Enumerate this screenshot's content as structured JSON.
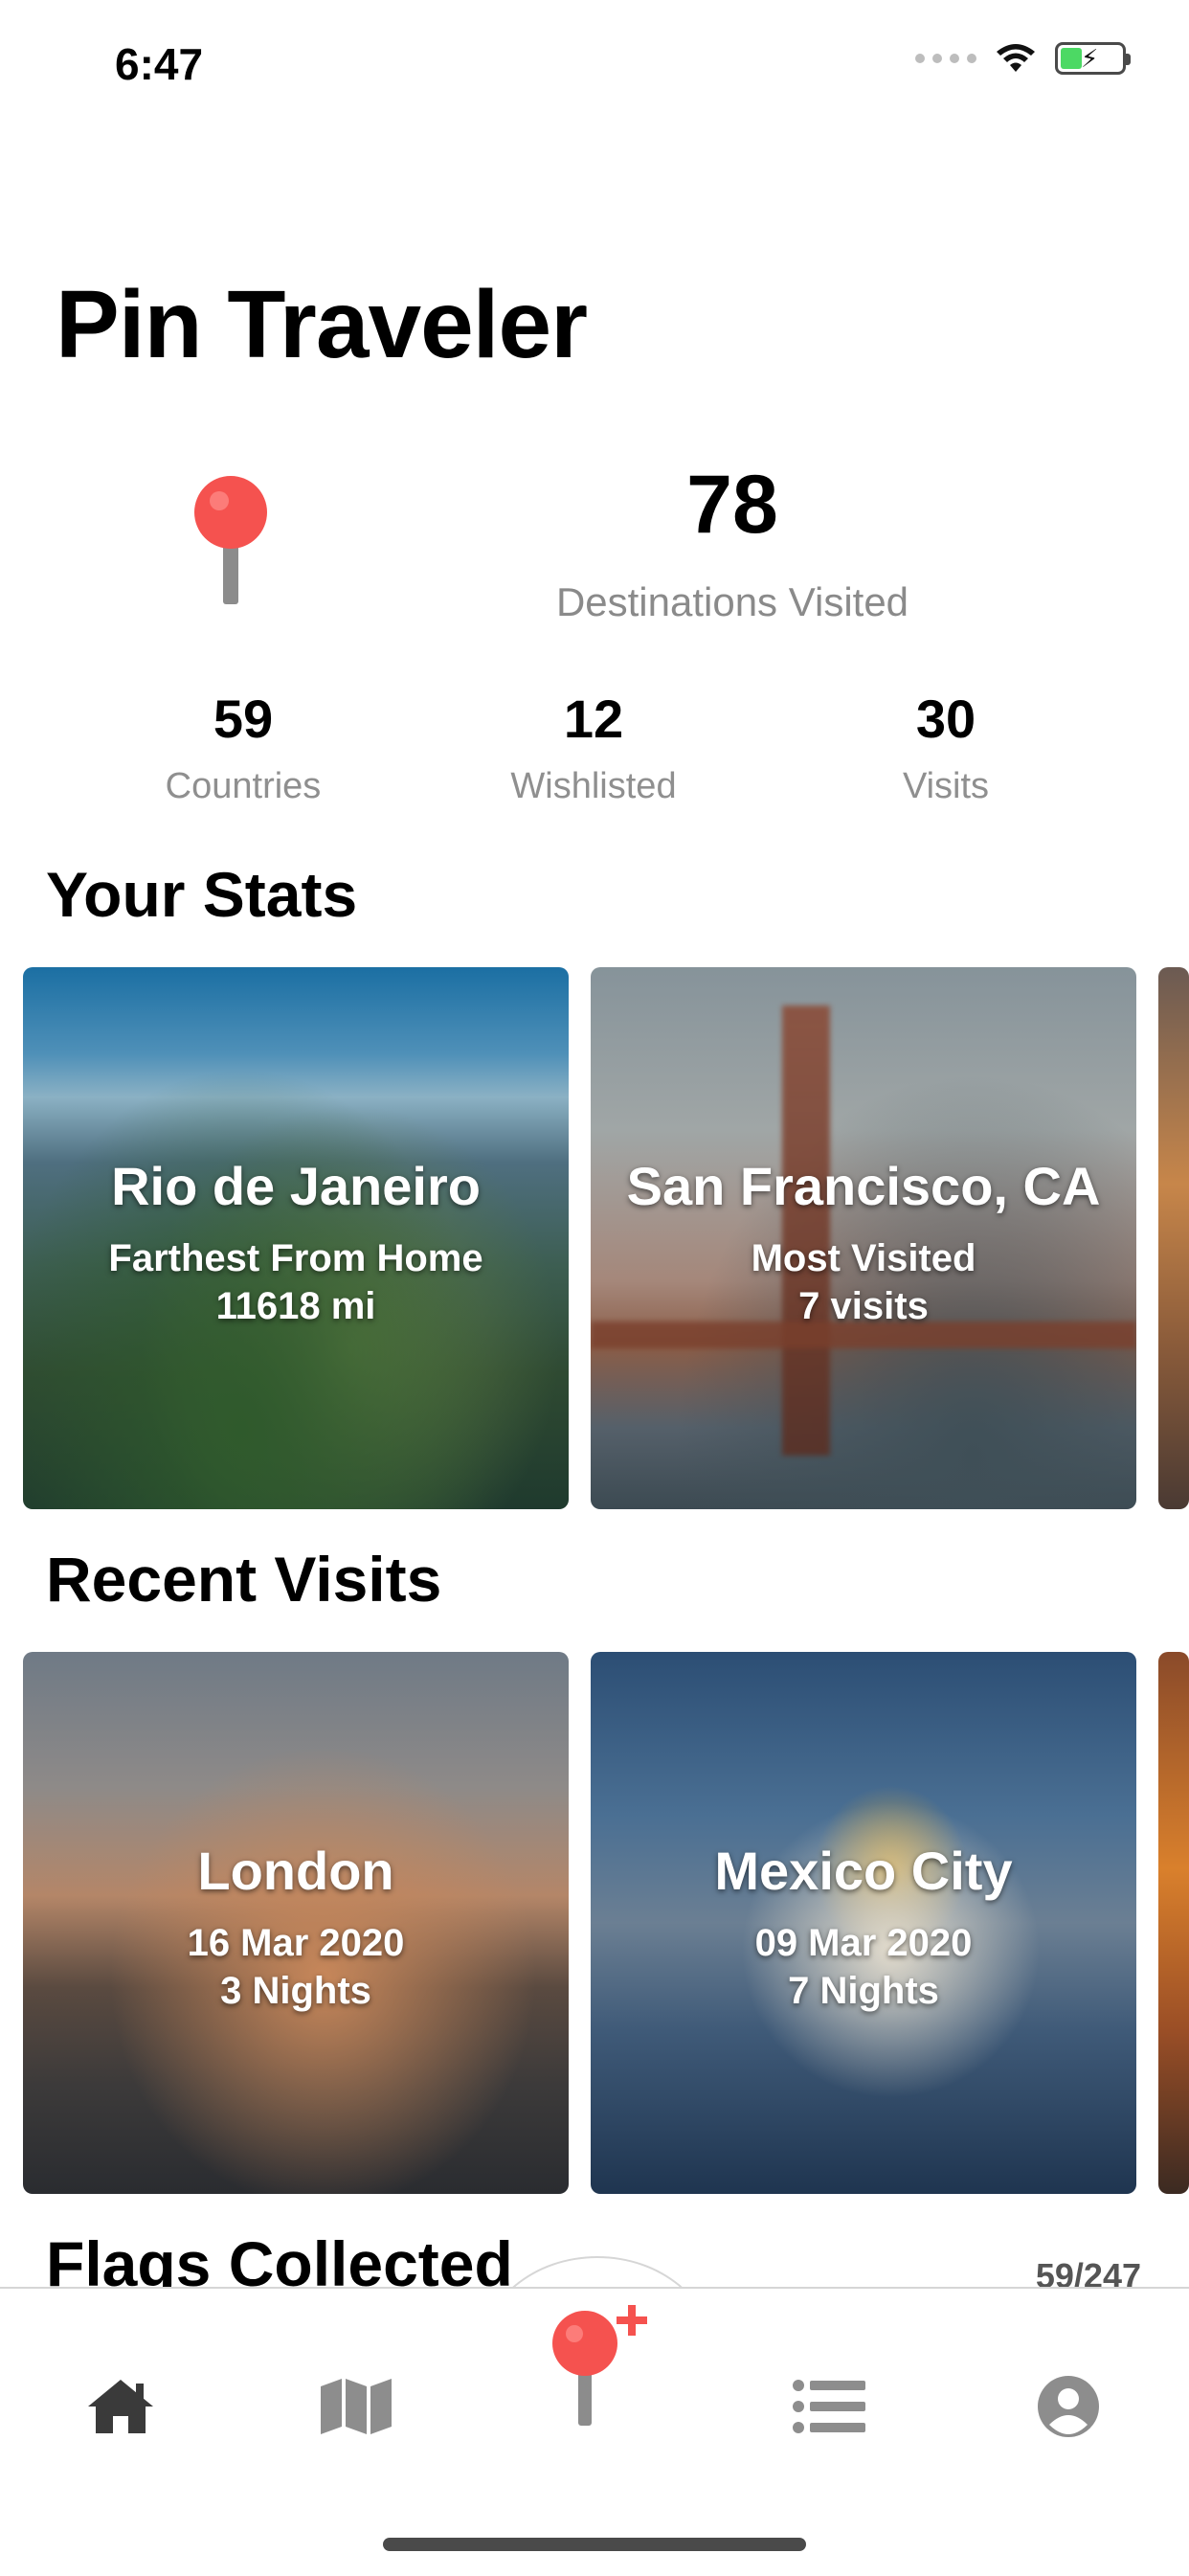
{
  "status_bar": {
    "time": "6:47"
  },
  "app": {
    "title": "Pin Traveler"
  },
  "hero": {
    "count": "78",
    "label": "Destinations Visited"
  },
  "stats": [
    {
      "value": "59",
      "label": "Countries"
    },
    {
      "value": "12",
      "label": "Wishlisted"
    },
    {
      "value": "30",
      "label": "Visits"
    }
  ],
  "your_stats": {
    "heading": "Your Stats",
    "cards": [
      {
        "title": "Rio de Janeiro",
        "line1": "Farthest From Home",
        "line2": "11618 mi"
      },
      {
        "title": "San Francisco, CA",
        "line1": "Most Visited",
        "line2": "7 visits"
      }
    ]
  },
  "recent_visits": {
    "heading": "Recent Visits",
    "cards": [
      {
        "title": "London",
        "line1": "16 Mar 2020",
        "line2": "3 Nights"
      },
      {
        "title": "Mexico City",
        "line1": "09 Mar 2020",
        "line2": "7 Nights"
      }
    ]
  },
  "flags": {
    "heading": "Flags Collected",
    "count": "59/247"
  },
  "tab_bar": {
    "items": [
      "home-icon",
      "map-icon",
      "add-pin-icon",
      "list-icon",
      "profile-icon"
    ],
    "accent": "#f44b4b"
  }
}
